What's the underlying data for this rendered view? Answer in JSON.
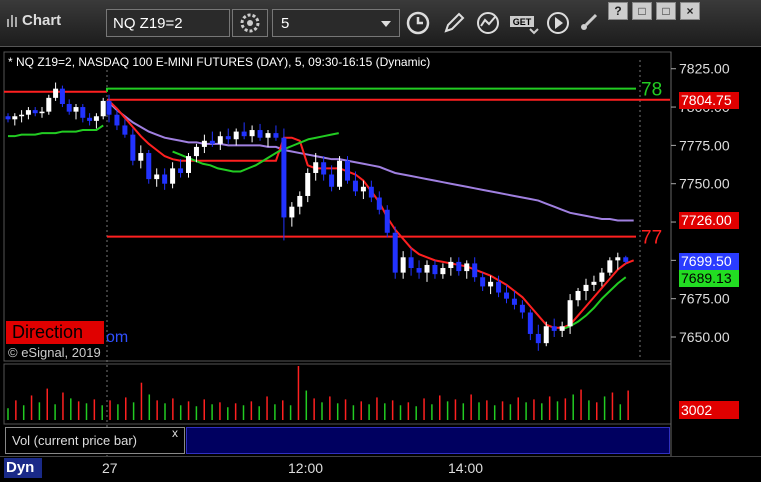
{
  "toolbar": {
    "app_title": "Chart",
    "symbol": "NQ Z19=2",
    "interval": "5",
    "get_label": "GET"
  },
  "window_buttons": [
    "?",
    "□",
    "□",
    "×"
  ],
  "chart_info": "* NQ Z19=2, NASDAQ 100 E-MINI FUTURES (DAY), 5, 09:30-16:15 (Dynamic)",
  "overlay": {
    "direction_label": "Direction",
    "direction_link": "om",
    "copyright": "© eSignal, 2019",
    "green_line_label": "78",
    "red_line_label": "77"
  },
  "price_labels": {
    "upper_red": "7804.75",
    "lower_red": "7726.00",
    "blue": "7699.50",
    "green": "7689.13",
    "volume": "3002"
  },
  "colors": {
    "up_candle": "#ffffff",
    "down_candle": "#2233ff",
    "green_line": "#22cc22",
    "red_line": "#ff2020",
    "purple_line": "#a080e0",
    "volume_up": "#22cc22",
    "volume_down": "#ff2020"
  },
  "volume_panel": {
    "title": "Vol (current price bar)",
    "close": "x"
  },
  "bottom": {
    "dyn_label": "Dyn",
    "time_labels": [
      "27",
      "12:00",
      "14:00"
    ]
  },
  "chart_data": {
    "type": "candlestick",
    "ylim": [
      7635,
      7832
    ],
    "y_ticks": [
      7825.0,
      7800.0,
      7775.0,
      7750.0,
      7725.0,
      7700.0,
      7675.0,
      7650.0
    ],
    "y_tick_labels": [
      "7825.00",
      "7800.00",
      "7775.00",
      "7750.00",
      "7725.00",
      "7700.00",
      "7675.00",
      "7650.00"
    ],
    "x_tick_labels": [
      "27",
      "12:00",
      "14:00"
    ],
    "horizontal_lines": [
      {
        "name": "green",
        "value": 7812,
        "color": "#22cc22"
      },
      {
        "name": "upper_red",
        "value": 7804.75,
        "color": "#ff2020"
      },
      {
        "name": "lower_red",
        "value": 7726.0,
        "color": "#ff2020"
      },
      {
        "name": "mid_red",
        "value": 7715.5,
        "color": "#ff2020"
      }
    ],
    "candles_prev": [
      {
        "o": 7794,
        "h": 7796,
        "l": 7790,
        "c": 7792
      },
      {
        "o": 7792,
        "h": 7796,
        "l": 7788,
        "c": 7794
      },
      {
        "o": 7794,
        "h": 7798,
        "l": 7790,
        "c": 7795
      },
      {
        "o": 7795,
        "h": 7800,
        "l": 7792,
        "c": 7798
      },
      {
        "o": 7798,
        "h": 7800,
        "l": 7794,
        "c": 7796
      },
      {
        "o": 7796,
        "h": 7800,
        "l": 7793,
        "c": 7797
      },
      {
        "o": 7797,
        "h": 7808,
        "l": 7795,
        "c": 7806
      },
      {
        "o": 7806,
        "h": 7816,
        "l": 7804,
        "c": 7812
      },
      {
        "o": 7812,
        "h": 7814,
        "l": 7800,
        "c": 7802
      },
      {
        "o": 7802,
        "h": 7805,
        "l": 7795,
        "c": 7797
      },
      {
        "o": 7797,
        "h": 7802,
        "l": 7792,
        "c": 7800
      },
      {
        "o": 7800,
        "h": 7802,
        "l": 7790,
        "c": 7793
      },
      {
        "o": 7793,
        "h": 7796,
        "l": 7788,
        "c": 7791
      },
      {
        "o": 7791,
        "h": 7796,
        "l": 7786,
        "c": 7794
      },
      {
        "o": 7794,
        "h": 7806,
        "l": 7792,
        "c": 7804
      }
    ],
    "candles": [
      {
        "o": 7804,
        "h": 7808,
        "l": 7790,
        "c": 7795
      },
      {
        "o": 7795,
        "h": 7798,
        "l": 7785,
        "c": 7788
      },
      {
        "o": 7788,
        "h": 7792,
        "l": 7780,
        "c": 7782
      },
      {
        "o": 7782,
        "h": 7786,
        "l": 7762,
        "c": 7765
      },
      {
        "o": 7765,
        "h": 7775,
        "l": 7760,
        "c": 7770
      },
      {
        "o": 7770,
        "h": 7772,
        "l": 7750,
        "c": 7753
      },
      {
        "o": 7753,
        "h": 7760,
        "l": 7748,
        "c": 7756
      },
      {
        "o": 7756,
        "h": 7760,
        "l": 7746,
        "c": 7750
      },
      {
        "o": 7750,
        "h": 7764,
        "l": 7747,
        "c": 7760
      },
      {
        "o": 7760,
        "h": 7766,
        "l": 7754,
        "c": 7757
      },
      {
        "o": 7757,
        "h": 7770,
        "l": 7754,
        "c": 7768
      },
      {
        "o": 7768,
        "h": 7776,
        "l": 7764,
        "c": 7774
      },
      {
        "o": 7774,
        "h": 7782,
        "l": 7770,
        "c": 7778
      },
      {
        "o": 7778,
        "h": 7784,
        "l": 7774,
        "c": 7776
      },
      {
        "o": 7776,
        "h": 7784,
        "l": 7772,
        "c": 7781
      },
      {
        "o": 7781,
        "h": 7786,
        "l": 7776,
        "c": 7779
      },
      {
        "o": 7779,
        "h": 7786,
        "l": 7775,
        "c": 7784
      },
      {
        "o": 7784,
        "h": 7790,
        "l": 7779,
        "c": 7781
      },
      {
        "o": 7781,
        "h": 7788,
        "l": 7777,
        "c": 7785
      },
      {
        "o": 7785,
        "h": 7789,
        "l": 7778,
        "c": 7780
      },
      {
        "o": 7780,
        "h": 7785,
        "l": 7774,
        "c": 7783
      },
      {
        "o": 7783,
        "h": 7788,
        "l": 7778,
        "c": 7780
      },
      {
        "o": 7780,
        "h": 7786,
        "l": 7713,
        "c": 7728
      },
      {
        "o": 7728,
        "h": 7738,
        "l": 7722,
        "c": 7735
      },
      {
        "o": 7735,
        "h": 7745,
        "l": 7730,
        "c": 7742
      },
      {
        "o": 7742,
        "h": 7760,
        "l": 7738,
        "c": 7757
      },
      {
        "o": 7757,
        "h": 7770,
        "l": 7752,
        "c": 7764
      },
      {
        "o": 7764,
        "h": 7768,
        "l": 7752,
        "c": 7756
      },
      {
        "o": 7756,
        "h": 7762,
        "l": 7745,
        "c": 7748
      },
      {
        "o": 7748,
        "h": 7768,
        "l": 7746,
        "c": 7765
      },
      {
        "o": 7765,
        "h": 7768,
        "l": 7750,
        "c": 7752
      },
      {
        "o": 7752,
        "h": 7758,
        "l": 7742,
        "c": 7745
      },
      {
        "o": 7745,
        "h": 7752,
        "l": 7740,
        "c": 7748
      },
      {
        "o": 7748,
        "h": 7752,
        "l": 7738,
        "c": 7741
      },
      {
        "o": 7741,
        "h": 7745,
        "l": 7730,
        "c": 7733
      },
      {
        "o": 7733,
        "h": 7736,
        "l": 7715,
        "c": 7718
      },
      {
        "o": 7718,
        "h": 7722,
        "l": 7688,
        "c": 7692
      },
      {
        "o": 7692,
        "h": 7706,
        "l": 7688,
        "c": 7702
      },
      {
        "o": 7702,
        "h": 7708,
        "l": 7690,
        "c": 7695
      },
      {
        "o": 7695,
        "h": 7700,
        "l": 7688,
        "c": 7692
      },
      {
        "o": 7692,
        "h": 7700,
        "l": 7686,
        "c": 7697
      },
      {
        "o": 7697,
        "h": 7700,
        "l": 7688,
        "c": 7691
      },
      {
        "o": 7691,
        "h": 7698,
        "l": 7688,
        "c": 7695
      },
      {
        "o": 7695,
        "h": 7702,
        "l": 7690,
        "c": 7699
      },
      {
        "o": 7699,
        "h": 7702,
        "l": 7690,
        "c": 7693
      },
      {
        "o": 7693,
        "h": 7700,
        "l": 7688,
        "c": 7698
      },
      {
        "o": 7698,
        "h": 7702,
        "l": 7686,
        "c": 7689
      },
      {
        "o": 7689,
        "h": 7692,
        "l": 7680,
        "c": 7683
      },
      {
        "o": 7683,
        "h": 7690,
        "l": 7678,
        "c": 7686
      },
      {
        "o": 7686,
        "h": 7690,
        "l": 7676,
        "c": 7679
      },
      {
        "o": 7679,
        "h": 7684,
        "l": 7672,
        "c": 7675
      },
      {
        "o": 7675,
        "h": 7680,
        "l": 7668,
        "c": 7671
      },
      {
        "o": 7671,
        "h": 7674,
        "l": 7662,
        "c": 7666
      },
      {
        "o": 7666,
        "h": 7668,
        "l": 7648,
        "c": 7652
      },
      {
        "o": 7652,
        "h": 7658,
        "l": 7641,
        "c": 7646
      },
      {
        "o": 7646,
        "h": 7660,
        "l": 7644,
        "c": 7657
      },
      {
        "o": 7657,
        "h": 7662,
        "l": 7650,
        "c": 7654
      },
      {
        "o": 7654,
        "h": 7660,
        "l": 7650,
        "c": 7657
      },
      {
        "o": 7657,
        "h": 7678,
        "l": 7652,
        "c": 7674
      },
      {
        "o": 7674,
        "h": 7682,
        "l": 7670,
        "c": 7680
      },
      {
        "o": 7680,
        "h": 7688,
        "l": 7674,
        "c": 7684
      },
      {
        "o": 7684,
        "h": 7690,
        "l": 7680,
        "c": 7686
      },
      {
        "o": 7686,
        "h": 7695,
        "l": 7683,
        "c": 7692
      },
      {
        "o": 7692,
        "h": 7702,
        "l": 7690,
        "c": 7700
      },
      {
        "o": 7700,
        "h": 7705,
        "l": 7694,
        "c": 7702
      },
      {
        "o": 7702,
        "h": 7703,
        "l": 7698,
        "c": 7699
      }
    ],
    "red_ma": [
      7804,
      7799,
      7793,
      7787,
      7781,
      7776,
      7772,
      7768,
      7766,
      7765,
      7765,
      7765,
      7765,
      7765,
      7765,
      7765,
      7765,
      7765,
      7765,
      7765,
      7765,
      7765,
      7780,
      7780,
      7778,
      7762,
      7760,
      7760,
      7760,
      7760,
      7758,
      7756,
      7752,
      7745,
      7738,
      7728,
      7720,
      7714,
      7708,
      7704,
      7702,
      7700,
      7699,
      7698,
      7697,
      7696,
      7694,
      7692,
      7690,
      7687,
      7684,
      7680,
      7676,
      7670,
      7664,
      7658,
      7656,
      7656,
      7658,
      7664,
      7670,
      7676,
      7682,
      7688,
      7694,
      7698,
      7700
    ],
    "purple_ma": [
      7803,
      7798,
      7794,
      7790,
      7787,
      7784,
      7782,
      7780,
      7779,
      7778,
      7777,
      7777,
      7776,
      7776,
      7776,
      7775,
      7775,
      7775,
      7775,
      7775,
      7774,
      7774,
      7772,
      7771,
      7770,
      7769,
      7768,
      7767,
      7766,
      7766,
      7765,
      7764,
      7763,
      7762,
      7761,
      7759,
      7757,
      7756,
      7755,
      7754,
      7753,
      7752,
      7751,
      7750,
      7749,
      7748,
      7747,
      7746,
      7745,
      7744,
      7743,
      7742,
      7741,
      7740,
      7739,
      7737,
      7735,
      7733,
      7731,
      7730,
      7729,
      7728,
      7727,
      7727,
      7726,
      7726,
      7726
    ],
    "green_ma_prev": [
      7781,
      7781,
      7782,
      7782,
      7782,
      7783,
      7783,
      7783,
      7784,
      7784,
      7784,
      7785,
      7785,
      7785,
      7788
    ],
    "green_ma": [
      7771,
      7769,
      7767,
      7765,
      7763,
      7762,
      7760,
      7759,
      7758,
      7758,
      7760,
      7762,
      7765,
      7768,
      7771,
      7773,
      7775,
      7777,
      7779,
      7780,
      7781,
      7782,
      7783
    ],
    "green_ma_end": [
      7655,
      7657,
      7660,
      7664,
      7669,
      7675,
      7680,
      7685,
      7689
    ],
    "volume": [
      {
        "v": 1200,
        "up": true
      },
      {
        "v": 2000,
        "up": false
      },
      {
        "v": 1500,
        "up": true
      },
      {
        "v": 2500,
        "up": false
      },
      {
        "v": 1800,
        "up": true
      },
      {
        "v": 3200,
        "up": false
      },
      {
        "v": 1600,
        "up": true
      },
      {
        "v": 2800,
        "up": false
      },
      {
        "v": 2200,
        "up": true
      },
      {
        "v": 1900,
        "up": false
      },
      {
        "v": 1700,
        "up": true
      },
      {
        "v": 2100,
        "up": false
      },
      {
        "v": 1500,
        "up": true
      },
      {
        "v": 2000,
        "up": false
      },
      {
        "v": 1600,
        "up": true
      },
      {
        "v": 2300,
        "up": false
      },
      {
        "v": 1800,
        "up": true
      },
      {
        "v": 3800,
        "up": false
      },
      {
        "v": 2600,
        "up": true
      },
      {
        "v": 2000,
        "up": false
      },
      {
        "v": 1700,
        "up": true
      },
      {
        "v": 2200,
        "up": false
      },
      {
        "v": 1500,
        "up": true
      },
      {
        "v": 1900,
        "up": false
      },
      {
        "v": 1400,
        "up": true
      },
      {
        "v": 2100,
        "up": false
      },
      {
        "v": 1600,
        "up": true
      },
      {
        "v": 1800,
        "up": false
      },
      {
        "v": 1300,
        "up": true
      },
      {
        "v": 1700,
        "up": false
      },
      {
        "v": 1500,
        "up": true
      },
      {
        "v": 1900,
        "up": false
      },
      {
        "v": 1400,
        "up": true
      },
      {
        "v": 2400,
        "up": false
      },
      {
        "v": 1600,
        "up": true
      },
      {
        "v": 2000,
        "up": false
      },
      {
        "v": 1500,
        "up": true
      },
      {
        "v": 5500,
        "up": false
      },
      {
        "v": 3000,
        "up": true
      },
      {
        "v": 2200,
        "up": false
      },
      {
        "v": 1800,
        "up": true
      },
      {
        "v": 2400,
        "up": false
      },
      {
        "v": 1700,
        "up": true
      },
      {
        "v": 2100,
        "up": false
      },
      {
        "v": 1500,
        "up": true
      },
      {
        "v": 1900,
        "up": false
      },
      {
        "v": 1600,
        "up": true
      },
      {
        "v": 2300,
        "up": false
      },
      {
        "v": 1700,
        "up": true
      },
      {
        "v": 2000,
        "up": false
      },
      {
        "v": 1500,
        "up": true
      },
      {
        "v": 1800,
        "up": false
      },
      {
        "v": 1400,
        "up": true
      },
      {
        "v": 2200,
        "up": false
      },
      {
        "v": 1600,
        "up": true
      },
      {
        "v": 2500,
        "up": false
      },
      {
        "v": 1900,
        "up": true
      },
      {
        "v": 2100,
        "up": false
      },
      {
        "v": 1700,
        "up": true
      },
      {
        "v": 2600,
        "up": false
      },
      {
        "v": 1800,
        "up": true
      },
      {
        "v": 2000,
        "up": false
      },
      {
        "v": 1500,
        "up": true
      },
      {
        "v": 1900,
        "up": false
      },
      {
        "v": 1600,
        "up": true
      },
      {
        "v": 2300,
        "up": false
      },
      {
        "v": 1800,
        "up": true
      },
      {
        "v": 2100,
        "up": false
      },
      {
        "v": 1700,
        "up": true
      },
      {
        "v": 2400,
        "up": false
      },
      {
        "v": 1900,
        "up": true
      },
      {
        "v": 2200,
        "up": false
      },
      {
        "v": 2600,
        "up": true
      },
      {
        "v": 3100,
        "up": false
      },
      {
        "v": 2000,
        "up": true
      },
      {
        "v": 1800,
        "up": false
      },
      {
        "v": 2400,
        "up": true
      },
      {
        "v": 2800,
        "up": false
      },
      {
        "v": 1600,
        "up": true
      },
      {
        "v": 3002,
        "up": false
      }
    ]
  }
}
